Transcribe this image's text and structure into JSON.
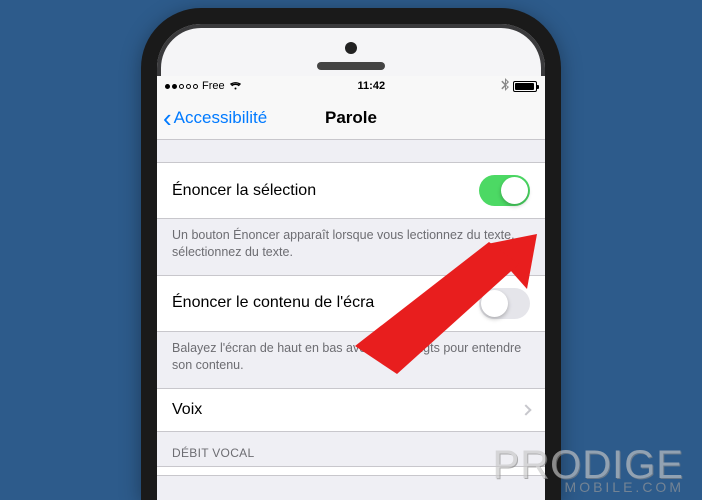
{
  "status": {
    "carrier": "Free",
    "time": "11:42"
  },
  "nav": {
    "back_label": "Accessibilité",
    "title": "Parole"
  },
  "rows": {
    "speak_selection": {
      "label": "Énoncer la sélection",
      "desc": "Un bouton Énoncer apparaît lorsque vous lectionnez du texte.",
      "on": true
    },
    "speak_screen": {
      "label": "Énoncer le contenu de l'écra",
      "desc": "Balayez l'écran de haut en bas avec deux doigts pour entendre son contenu.",
      "on": false
    },
    "voice": {
      "label": "Voix"
    },
    "rate_header": "DÉBIT VOCAL",
    "partial_desc": "sélectionnez du texte."
  },
  "watermark": {
    "main": "PRODIGE",
    "sub": "MOBILE.COM"
  }
}
